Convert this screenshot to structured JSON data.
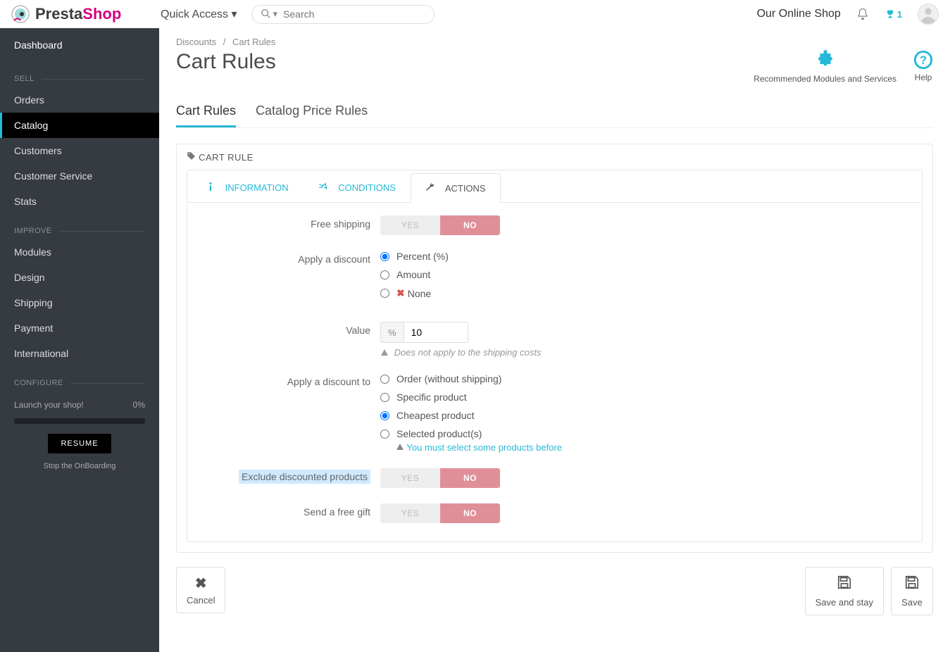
{
  "topbar": {
    "quickaccess": "Quick Access",
    "search_placeholder": "Search",
    "shop_name": "Our Online Shop",
    "trophy_count": "1"
  },
  "sidebar": {
    "dashboard": "Dashboard",
    "sections": {
      "sell": "SELL",
      "improve": "IMPROVE",
      "configure": "CONFIGURE"
    },
    "sell_items": [
      "Orders",
      "Catalog",
      "Customers",
      "Customer Service",
      "Stats"
    ],
    "improve_items": [
      "Modules",
      "Design",
      "Shipping",
      "Payment",
      "International"
    ],
    "launch_label": "Launch your shop!",
    "launch_pct": "0%",
    "resume": "RESUME",
    "stop_onb": "Stop the OnBoarding"
  },
  "breadcrumb": {
    "parent": "Discounts",
    "current": "Cart Rules"
  },
  "page": {
    "title": "Cart Rules",
    "recommended": "Recommended Modules and Services",
    "help": "Help"
  },
  "subtabs": {
    "cart_rules": "Cart Rules",
    "catalog_price_rules": "Catalog Price Rules"
  },
  "panel": {
    "heading": "CART RULE",
    "tabs": {
      "information": "INFORMATION",
      "conditions": "CONDITIONS",
      "actions": "ACTIONS"
    }
  },
  "form": {
    "free_shipping_label": "Free shipping",
    "yes": "YES",
    "no": "NO",
    "apply_discount_label": "Apply a discount",
    "opt_percent": "Percent (%)",
    "opt_amount": "Amount",
    "opt_none": "None",
    "value_label": "Value",
    "value_unit": "%",
    "value": "10",
    "value_help": "Does not apply to the shipping costs",
    "apply_to_label": "Apply a discount to",
    "to_order": "Order (without shipping)",
    "to_specific": "Specific product",
    "to_cheapest": "Cheapest product",
    "to_selected": "Selected product(s)",
    "to_selected_msg": "You must select some products before",
    "exclude_label": "Exclude discounted products",
    "gift_label": "Send a free gift"
  },
  "footer": {
    "cancel": "Cancel",
    "save_stay": "Save and stay",
    "save": "Save"
  }
}
